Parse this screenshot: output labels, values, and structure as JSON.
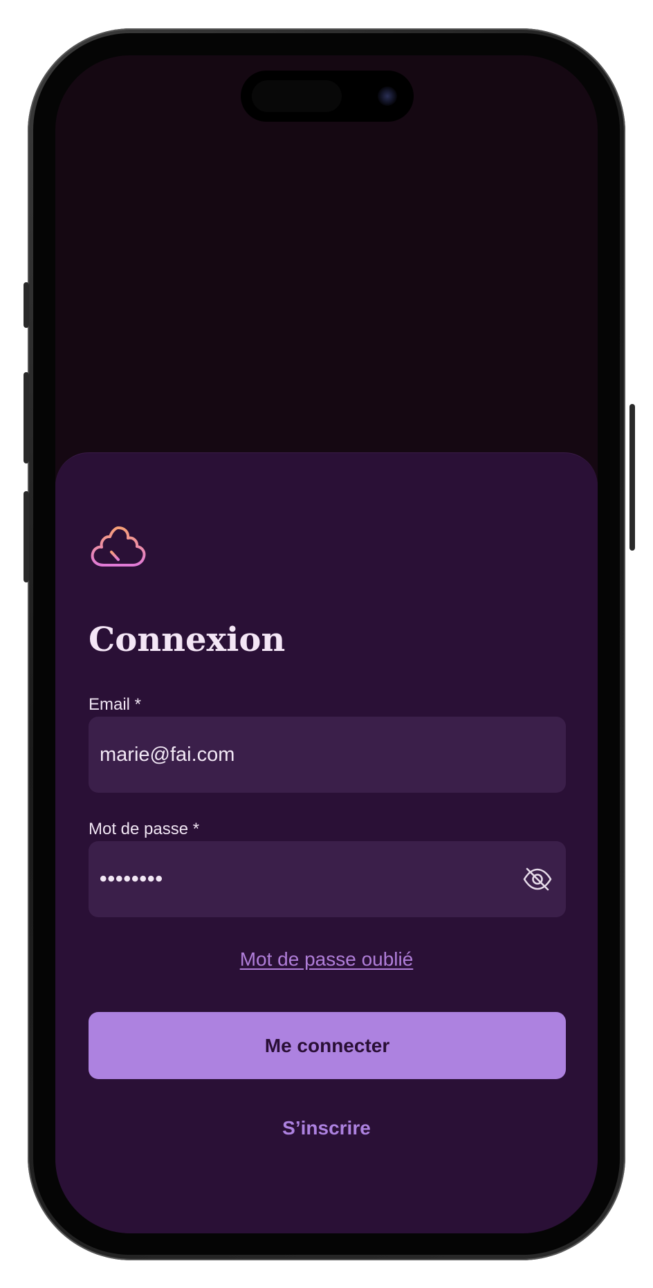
{
  "login": {
    "title": "Connexion",
    "email_label": "Email *",
    "email_value": "marie@fai.com",
    "password_label": "Mot de passe *",
    "password_value": "••••••••",
    "forgot_link": "Mot de passe oublié",
    "submit_label": "Me connecter",
    "signup_link": "S’inscrire"
  },
  "icons": {
    "logo": "tree-icon",
    "password_toggle": "eye-off-icon"
  },
  "colors": {
    "background": "#150812",
    "sheet": "#2a1036",
    "input": "#3b1f4a",
    "accent": "#ad82e0",
    "logo_gradient_start": "#f7a077",
    "logo_gradient_end": "#e07ad6"
  }
}
